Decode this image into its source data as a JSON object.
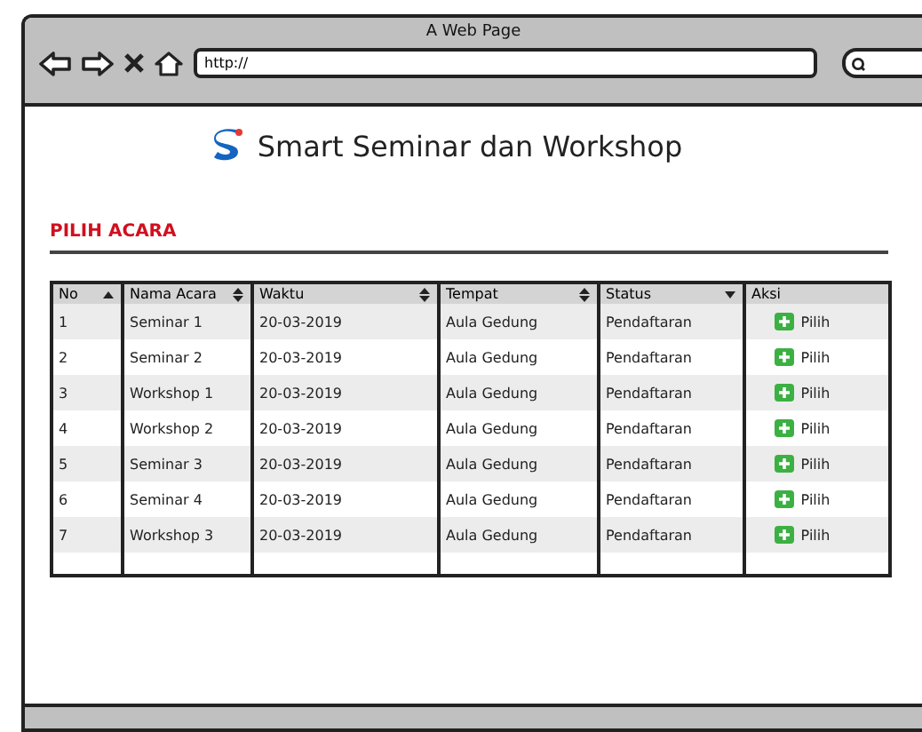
{
  "window": {
    "title": "A Web Page",
    "url": "http://"
  },
  "header": {
    "title": "Smart Seminar dan Workshop"
  },
  "section": {
    "title": "PILIH ACARA"
  },
  "table": {
    "columns": [
      {
        "label": "No",
        "sortable": true,
        "sorted": true,
        "descending": false
      },
      {
        "label": "Nama Acara",
        "sortable": true,
        "sorted": false
      },
      {
        "label": "Waktu",
        "sortable": true,
        "sorted": false
      },
      {
        "label": "Tempat",
        "sortable": true,
        "sorted": false
      },
      {
        "label": "Status",
        "sortable": true,
        "sorted": true,
        "descending": true
      },
      {
        "label": "Aksi",
        "sortable": false
      }
    ],
    "rows": [
      {
        "no": "1",
        "name": "Seminar 1",
        "time": "20-03-2019",
        "place": "Aula Gedung",
        "status": "Pendaftaran",
        "action": "Pilih"
      },
      {
        "no": "2",
        "name": "Seminar 2",
        "time": "20-03-2019",
        "place": "Aula Gedung",
        "status": "Pendaftaran",
        "action": "Pilih"
      },
      {
        "no": "3",
        "name": "Workshop 1",
        "time": "20-03-2019",
        "place": "Aula Gedung",
        "status": "Pendaftaran",
        "action": "Pilih"
      },
      {
        "no": "4",
        "name": "Workshop 2",
        "time": "20-03-2019",
        "place": "Aula Gedung",
        "status": "Pendaftaran",
        "action": "Pilih"
      },
      {
        "no": "5",
        "name": "Seminar 3",
        "time": "20-03-2019",
        "place": "Aula Gedung",
        "status": "Pendaftaran",
        "action": "Pilih"
      },
      {
        "no": "6",
        "name": "Seminar 4",
        "time": "20-03-2019",
        "place": "Aula Gedung",
        "status": "Pendaftaran",
        "action": "Pilih"
      },
      {
        "no": "7",
        "name": "Workshop 3",
        "time": "20-03-2019",
        "place": "Aula Gedung",
        "status": "Pendaftaran",
        "action": "Pilih"
      }
    ]
  }
}
